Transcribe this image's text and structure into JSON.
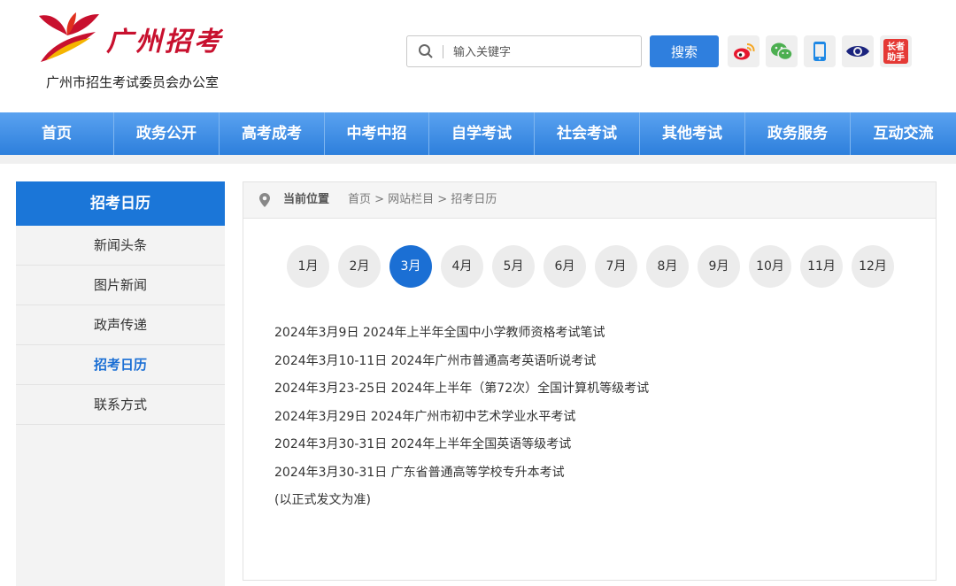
{
  "header": {
    "logo_calligraphy": "广州招考",
    "logo_subtitle": "广州市招生考试委员会办公室",
    "search_placeholder": "输入关键字",
    "search_button": "搜索",
    "social_icons": [
      "weibo-icon",
      "wechat-icon",
      "mobile-icon",
      "eye-icon",
      "elder-helper-icon"
    ],
    "elder_helper_text": "长者助手"
  },
  "nav": {
    "items": [
      "首页",
      "政务公开",
      "高考成考",
      "中考中招",
      "自学考试",
      "社会考试",
      "其他考试",
      "政务服务",
      "互动交流"
    ]
  },
  "sidebar": {
    "title": "招考日历",
    "items": [
      "新闻头条",
      "图片新闻",
      "政声传递",
      "招考日历",
      "联系方式"
    ],
    "active_index": 3
  },
  "breadcrumb": {
    "label": "当前位置",
    "path": "首页 > 网站栏目 > 招考日历"
  },
  "calendar": {
    "months": [
      "1月",
      "2月",
      "3月",
      "4月",
      "5月",
      "6月",
      "7月",
      "8月",
      "9月",
      "10月",
      "11月",
      "12月"
    ],
    "active_month_index": 2,
    "events": [
      "2024年3月9日 2024年上半年全国中小学教师资格考试笔试",
      "2024年3月10-11日 2024年广州市普通高考英语听说考试",
      "2024年3月23-25日 2024年上半年（第72次）全国计算机等级考试",
      "2024年3月29日 2024年广州市初中艺术学业水平考试",
      "2024年3月30-31日 2024年上半年全国英语等级考试",
      "2024年3月30-31日 广东省普通高等学校专升本考试",
      "(以正式发文为准)"
    ]
  },
  "colors": {
    "accent": "#1b6fd4",
    "nav_top": "#5aa2f0",
    "nav_bottom": "#2d7fdc",
    "logo_red": "#c8102e",
    "logo_yellow": "#f5b400"
  }
}
